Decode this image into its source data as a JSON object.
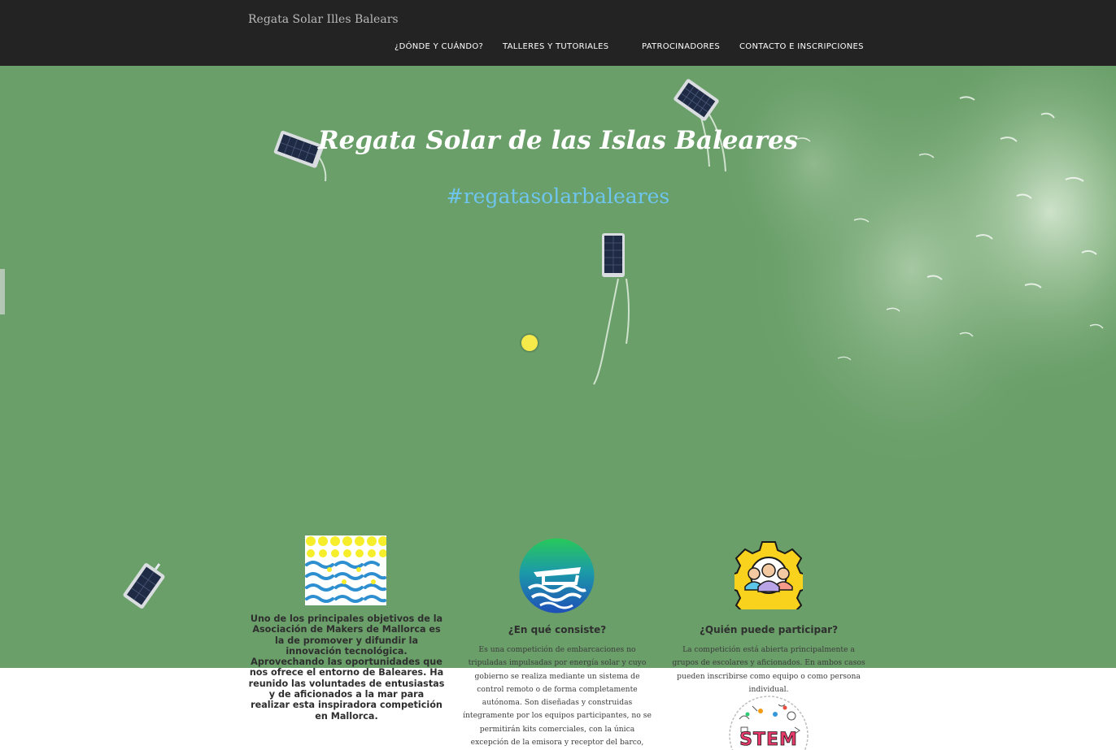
{
  "header": {
    "site_title": "Regata Solar Illes Balears",
    "nav": [
      {
        "label": "¿DÓNDE Y CUÁNDO?"
      },
      {
        "label": "TALLERES Y TUTORIALES"
      },
      {
        "label": "PATROCINADORES"
      },
      {
        "label": "CONTACTO E INSCRIPCIONES"
      }
    ]
  },
  "hero": {
    "title": "Regata Solar de las Islas Baleares",
    "hashtag": "#regatasolarbaleares",
    "colors": {
      "water": "#6a9f69",
      "hashtag": "#6ec5ee"
    }
  },
  "intro": {
    "text": "Uno de los principales objetivos de la Asociación de Makers de Mallorca es la de promover y difundir la innovación tecnológica. Aprovechando las oportunidades que nos ofrece el entorno de Baleares. Ha reunido las voluntades de entusiastas y de aficionados a la mar para realizar esta inspiradora competición en Mallorca.",
    "icon": "waves-sun-pattern-icon"
  },
  "features": [
    {
      "icon": "solar-boat-icon",
      "title": "¿En qué consiste?",
      "body": "Es una competición de embarcaciones no tripuladas impulsadas por energía solar y cuyo gobierno se realiza mediante un sistema de control remoto o de forma completamente autónoma. Son diseñadas y construidas íntegramente por los equipos participantes, no se permitirán kits comerciales, con la única excepción de la emisora y receptor del barco, fomentando así la originalidad, el desarrollo"
    },
    {
      "icon": "team-gear-icon",
      "title": "¿Quién puede participar?",
      "body": "La competición está abierta principalmente a grupos de escolares y aficionados. En ambos casos pueden inscribirse como equipo o como persona individual.",
      "extra_icon": "stem-doodle-icon",
      "extra_icon_text": "STEM"
    }
  ]
}
